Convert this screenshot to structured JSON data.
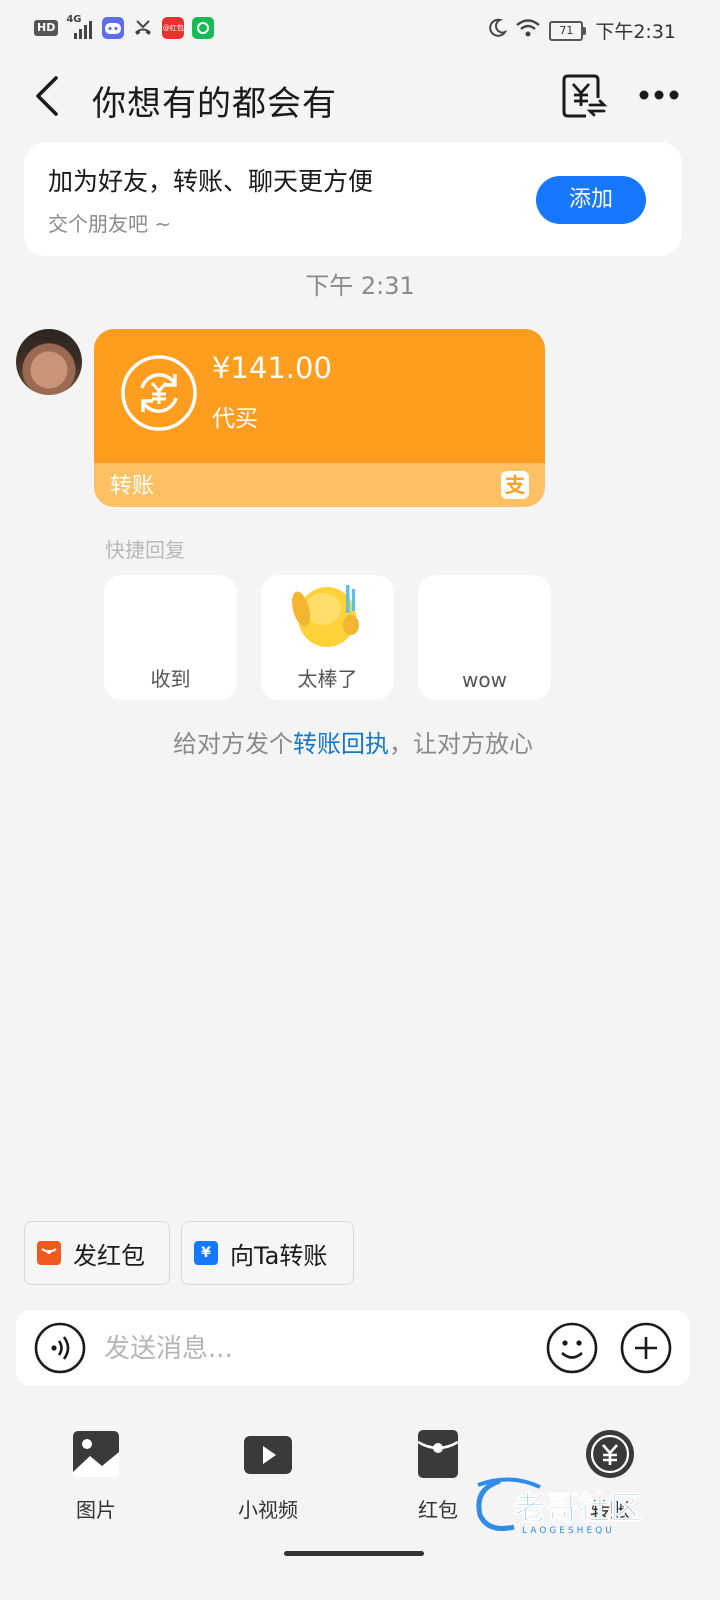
{
  "status_bar": {
    "hd": "HD",
    "network": "4G",
    "weibo_label": "@红包",
    "battery": "71",
    "time": "下午2:31"
  },
  "header": {
    "title": "你想有的都会有",
    "bill_icon": "yuan-bill-icon",
    "more_icon": "more-dots-icon"
  },
  "add_friend": {
    "main_text": "加为好友，转账、聊天更方便",
    "sub_text": "交个朋友吧 ~",
    "button_label": "添加"
  },
  "timestamp": "下午 2:31",
  "transfer": {
    "amount": "¥141.00",
    "note": "代买",
    "kind": "转账",
    "alipay_glyph": "支"
  },
  "quick_reply": {
    "title": "快捷回复",
    "items": [
      {
        "label": "收到"
      },
      {
        "label": "太棒了"
      },
      {
        "label": "wow"
      }
    ]
  },
  "receipt": {
    "prefix": "给对方发个",
    "link": "转账回执",
    "suffix": "，让对方放心"
  },
  "shortcuts": [
    {
      "label": "发红包",
      "icon": "red-envelope-icon",
      "color": "#f05a1e"
    },
    {
      "label": "向Ta转账",
      "icon": "transfer-icon",
      "color": "#1677ff"
    }
  ],
  "input": {
    "placeholder": "发送消息..."
  },
  "toolbar": [
    {
      "label": "图片",
      "icon": "image-icon"
    },
    {
      "label": "小视频",
      "icon": "video-icon"
    },
    {
      "label": "红包",
      "icon": "red-envelope-icon"
    },
    {
      "label": "转账",
      "icon": "transfer-icon"
    }
  ],
  "watermark": {
    "text": "老哥社区",
    "sub": "LAOGESHEQU"
  },
  "colors": {
    "accent": "#1677ff",
    "transfer_orange": "#ff9d1e",
    "transfer_light": "#ffbf63",
    "link_blue": "#1677cc"
  }
}
